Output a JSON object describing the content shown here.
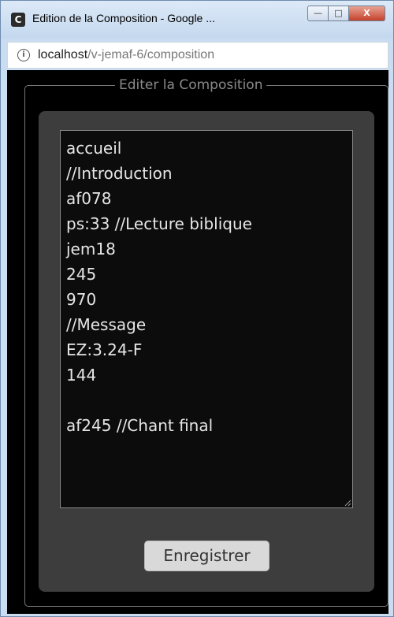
{
  "window": {
    "title": "Edition de la Composition - Google ...",
    "app_icon_letter": "C",
    "buttons": {
      "minimize": "—",
      "maximize": "□",
      "close": "X"
    }
  },
  "addressbar": {
    "info_glyph": "i",
    "url_host": "localhost",
    "url_path": "/v-jemaf-6/composition"
  },
  "form": {
    "legend": "Editer la Composition",
    "composition_lines": [
      "accueil",
      "//Introduction",
      "af078",
      "ps:33 //Lecture biblique",
      "jem18",
      "245",
      "970",
      "//Message",
      "EZ:3.24-F",
      "144",
      "",
      "af245 //Chant final"
    ],
    "save_label": "Enregistrer"
  },
  "colors": {
    "background": "#000000",
    "panel": "#3d3d3d",
    "editor_bg": "#0c0c0c",
    "editor_text": "#e6e6e6",
    "legend_text": "#8a8a8a",
    "button_bg": "#d9d9d9"
  }
}
